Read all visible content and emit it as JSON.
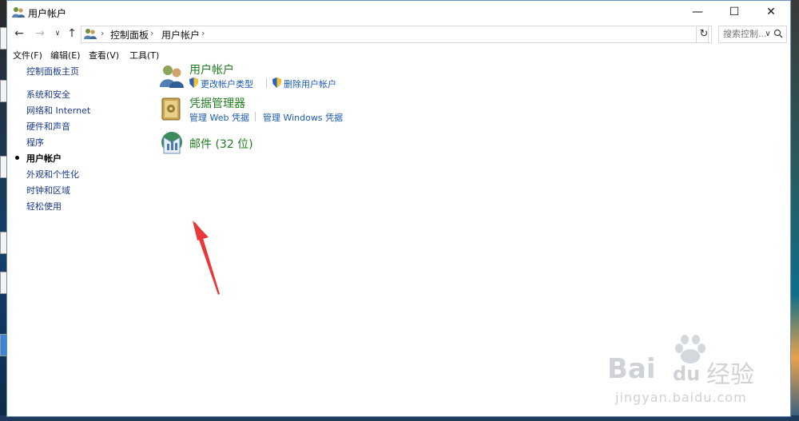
{
  "window": {
    "title": "用户帐户",
    "controls": {
      "minimize": "—",
      "maximize": "☐",
      "close": "✕"
    }
  },
  "addressbar": {
    "crumbs": [
      "控制面板",
      "用户帐户"
    ],
    "search_placeholder": "搜索控制..."
  },
  "menubar": {
    "items": [
      "文件(F)",
      "编辑(E)",
      "查看(V)",
      "工具(T)"
    ]
  },
  "sidebar": {
    "home": "控制面板主页",
    "items": [
      {
        "label": "系统和安全"
      },
      {
        "label": "网络和 Internet"
      },
      {
        "label": "硬件和声音"
      },
      {
        "label": "程序"
      },
      {
        "label": "用户帐户",
        "current": true
      },
      {
        "label": "外观和个性化"
      },
      {
        "label": "时钟和区域"
      },
      {
        "label": "轻松使用"
      }
    ]
  },
  "categories": {
    "user_accounts": {
      "title": "用户帐户",
      "links": [
        "更改帐户类型",
        "删除用户帐户"
      ]
    },
    "credential_manager": {
      "title": "凭据管理器",
      "links": [
        "管理 Web 凭据",
        "管理 Windows 凭据"
      ]
    },
    "mail": {
      "title": "邮件 (32 位)"
    }
  },
  "watermark": {
    "brand": "Bai",
    "brand_mid": "du",
    "brand_cn": "经验",
    "url": "jingyan.baidu.com"
  },
  "colors": {
    "category_title": "#1f7d1f",
    "link": "#1a5bb3",
    "nav_link": "#1a3a8c",
    "annotation_arrow": "#e8393a"
  }
}
